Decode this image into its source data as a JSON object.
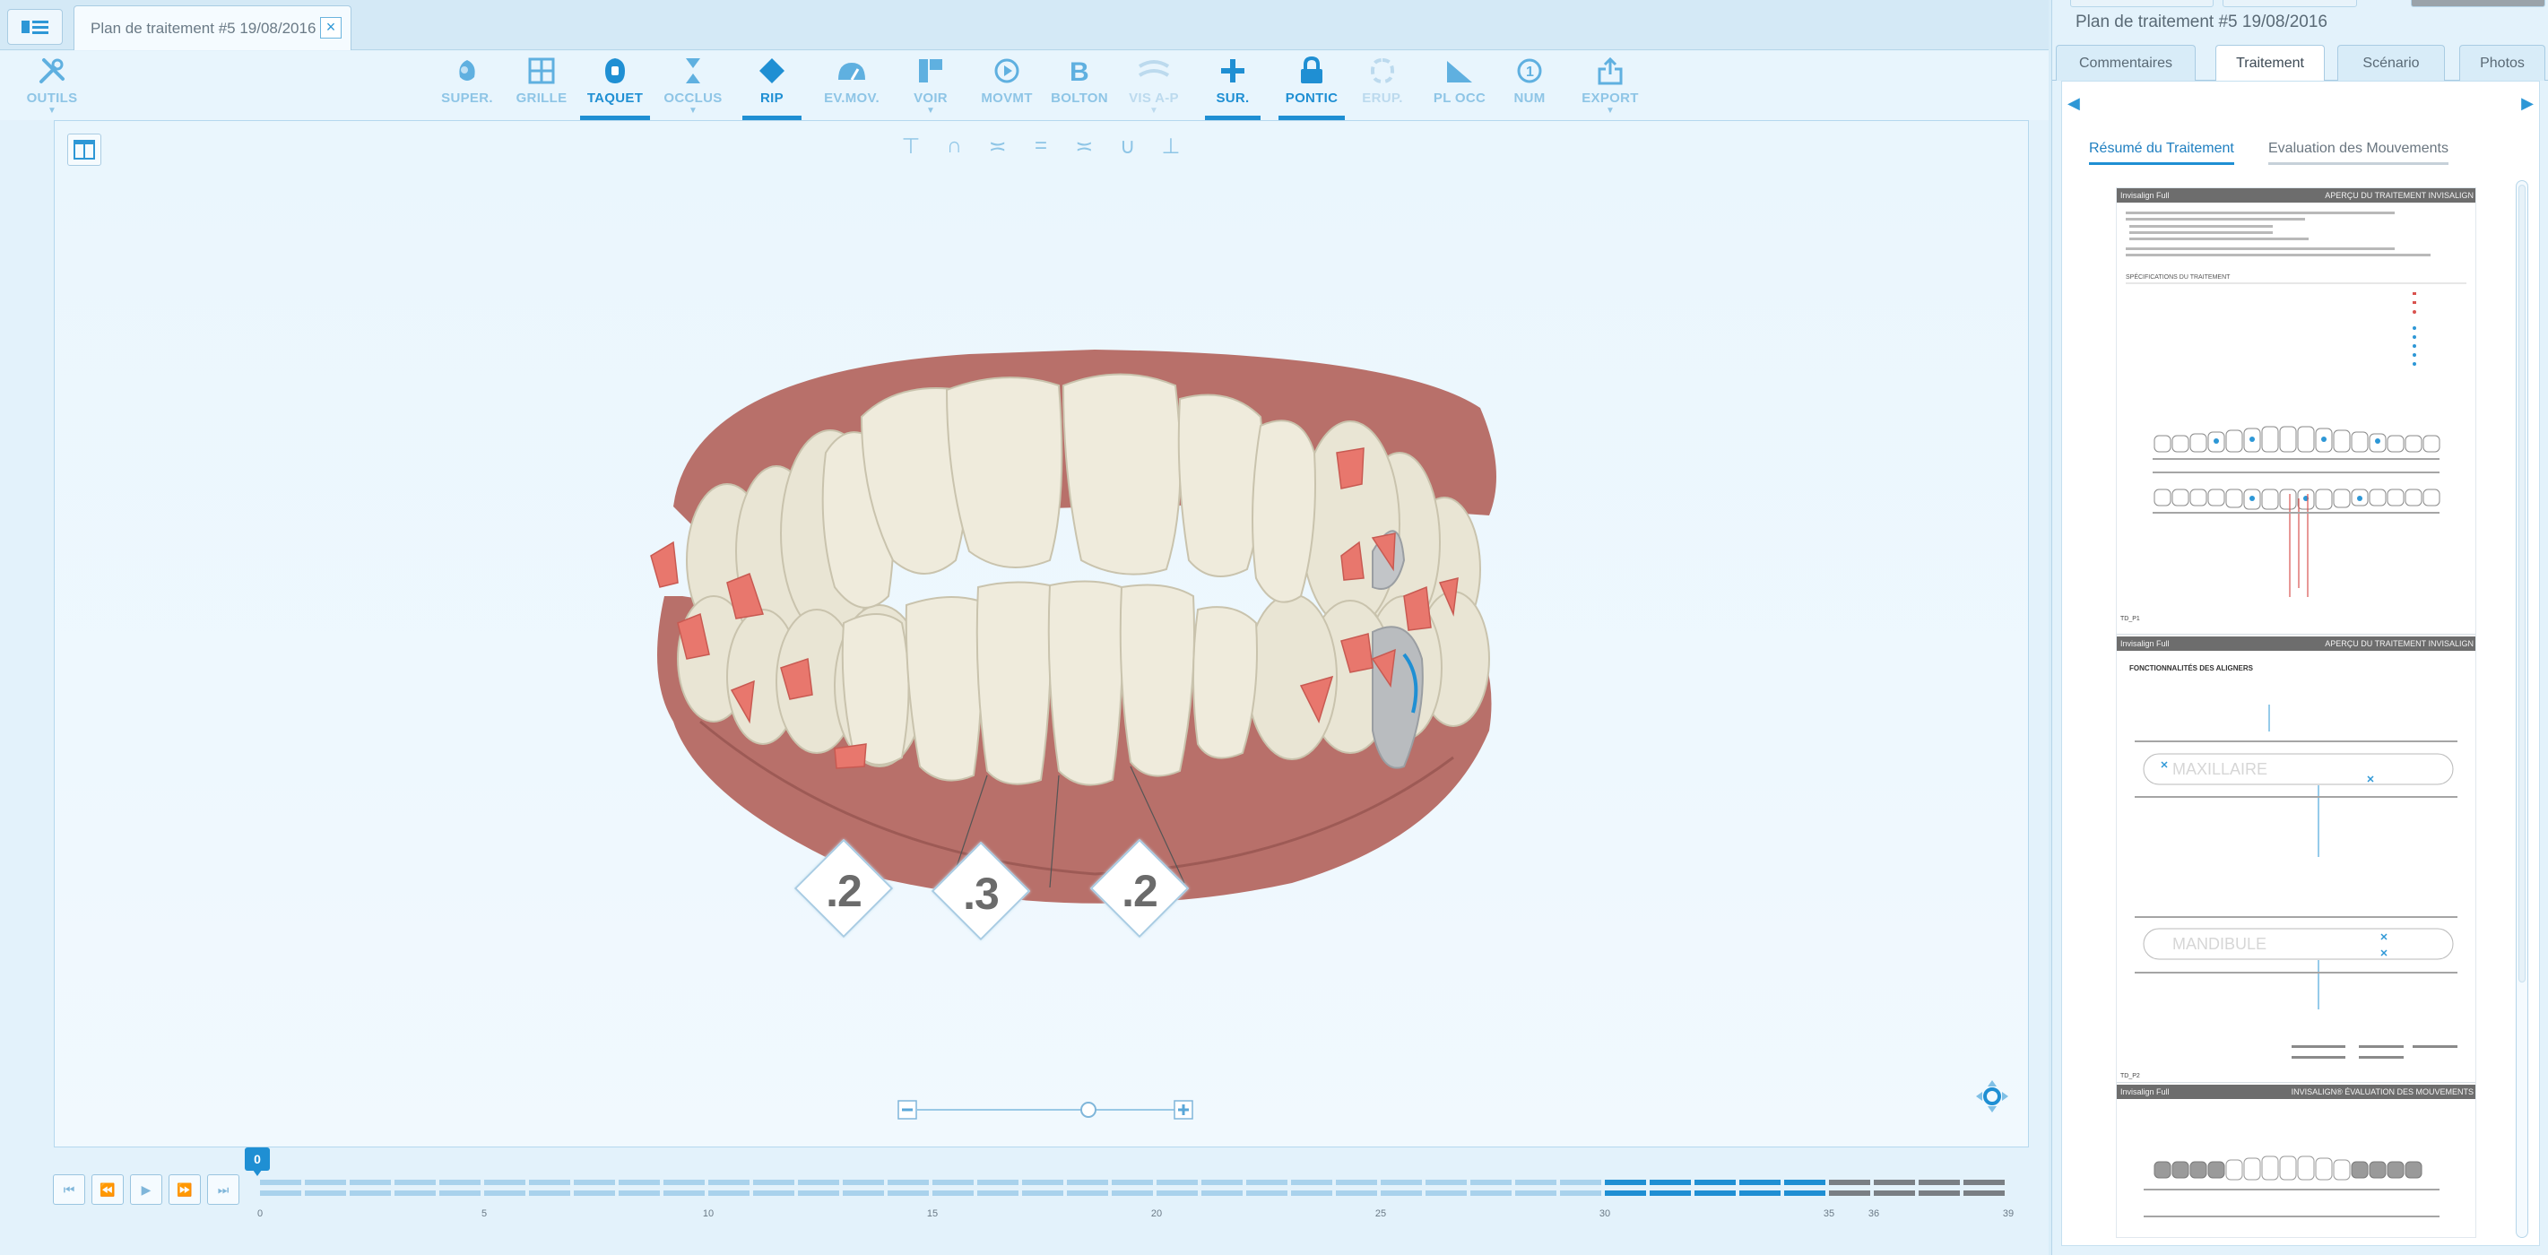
{
  "tab": {
    "title": "Plan de traitement #5 19/08/2016",
    "close": "×"
  },
  "tools": {
    "outils": "OUTILS",
    "items": [
      {
        "label": "SUPER.",
        "icon": "superimposition-icon",
        "state": "dim",
        "caret": ""
      },
      {
        "label": "GRILLE",
        "icon": "grid-icon",
        "state": "dim",
        "caret": ""
      },
      {
        "label": "TAQUET",
        "icon": "attachment-icon",
        "state": "sel",
        "caret": ""
      },
      {
        "label": "OCCLUS",
        "icon": "occlusion-icon",
        "state": "dim",
        "caret": "▼"
      },
      {
        "label": "RIP",
        "icon": "ipr-diamond-icon",
        "state": "sel",
        "caret": ""
      },
      {
        "label": "EV.MOV.",
        "icon": "movement-gauge-icon",
        "state": "dim",
        "caret": ""
      },
      {
        "label": "VOIR",
        "icon": "view-icon",
        "state": "dim",
        "caret": "▼"
      },
      {
        "label": "MOVMT",
        "icon": "movement-icon",
        "state": "dim",
        "caret": ""
      },
      {
        "label": "BOLTON",
        "icon": "bolton-icon",
        "state": "dim",
        "caret": ""
      },
      {
        "label": "VIS A-P",
        "icon": "ap-view-icon",
        "state": "faded",
        "caret": "▼"
      },
      {
        "label": "SUR.",
        "icon": "plus-icon",
        "state": "sel",
        "caret": ""
      },
      {
        "label": "PONTIC",
        "icon": "pontic-lock-icon",
        "state": "sel",
        "caret": ""
      },
      {
        "label": "ERUP.",
        "icon": "eruption-icon",
        "state": "faded",
        "caret": ""
      },
      {
        "label": "PL OCC",
        "icon": "occlusal-plane-icon",
        "state": "dim",
        "caret": ""
      },
      {
        "label": "NUM",
        "icon": "numbering-icon",
        "state": "dim",
        "caret": ""
      },
      {
        "label": "EXPORT",
        "icon": "export-icon",
        "state": "dim",
        "caret": "▼"
      }
    ]
  },
  "ipr": [
    ".2",
    ".3",
    ".2"
  ],
  "timeline": {
    "current": "0",
    "labels": [
      "0",
      "5",
      "10",
      "15",
      "20",
      "25",
      "30",
      "35",
      "36",
      "39"
    ],
    "stages": 39,
    "highlight_from": 31,
    "highlight_to": 35
  },
  "side": {
    "title": "Plan de traitement #5 19/08/2016",
    "tabs": [
      "Commentaires",
      "Traitement",
      "Scénario",
      "Photos"
    ],
    "active_tab": "Traitement",
    "subtabs": [
      "Résumé du Traitement",
      "Evaluation des Mouvements"
    ],
    "pages": [
      {
        "left": "Invisalign Full",
        "right": "APERÇU DU TRAITEMENT INVISALIGN",
        "section": "SPÉCIFICATIONS DU TRAITEMENT",
        "footer": "TD_P1"
      },
      {
        "left": "Invisalign Full",
        "right": "APERÇU DU TRAITEMENT INVISALIGN",
        "section": "FONCTIONNALITÉS DES ALIGNERS",
        "upper": "MAXILLAIRE",
        "lower": "MANDIBULE",
        "footer": "TD_P2"
      },
      {
        "left": "Invisalign Full",
        "right": "INVISALIGN® ÉVALUATION DES MOUVEMENTS"
      }
    ]
  },
  "colors": {
    "accent": "#1f8fd3",
    "gum": "#b8706a",
    "tooth": "#ece8d8",
    "attachment": "#e8776d"
  }
}
